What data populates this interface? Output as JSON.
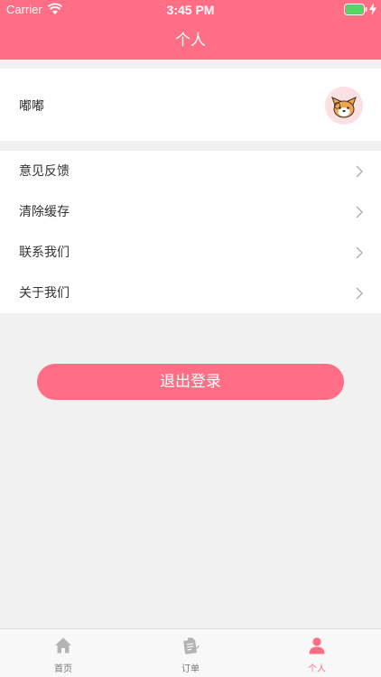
{
  "status_bar": {
    "carrier": "Carrier",
    "time": "3:45 PM"
  },
  "nav": {
    "title": "个人"
  },
  "profile": {
    "username": "嘟嘟"
  },
  "menu": [
    {
      "label": "意见反馈"
    },
    {
      "label": "清除缓存"
    },
    {
      "label": "联系我们"
    },
    {
      "label": "关于我们"
    }
  ],
  "logout": {
    "label": "退出登录"
  },
  "tabbar": {
    "tabs": [
      {
        "label": "首页",
        "icon": "home-icon"
      },
      {
        "label": "订单",
        "icon": "order-icon"
      },
      {
        "label": "个人",
        "icon": "person-icon",
        "active": true
      }
    ]
  },
  "colors": {
    "primary": "#ff6e84",
    "background": "#f1f1f1"
  }
}
